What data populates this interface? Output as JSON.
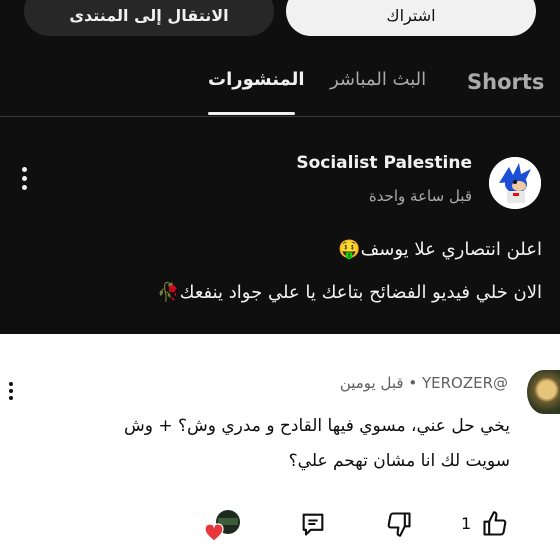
{
  "top_buttons": {
    "subscribe": "اشتراك",
    "go_to_forum": "الانتقال إلى المنتدى"
  },
  "tabs": {
    "shorts": "Shorts",
    "live": "البث المباشر",
    "posts": "المنشورات"
  },
  "post": {
    "channel": "Socialist Palestine",
    "time": "قبل ساعة واحدة",
    "line1": "اعلن انتصاري علا يوسف🤑",
    "line2": "الان خلي فيديو الفضائح بتاعك يا علي جواد ينفعك🥀"
  },
  "comment": {
    "header": "@YEROZER • قبل يومين",
    "line1": "يخي حل عني، مسوي فيها القادح و مدري وش؟ + وش",
    "line2": "سويت لك انا مشان تهحم علي؟",
    "likes": "1"
  },
  "icons": [
    "more-vert-icon",
    "thumb-up-icon",
    "thumb-down-icon",
    "reply-icon",
    "creator-heart-icon"
  ]
}
